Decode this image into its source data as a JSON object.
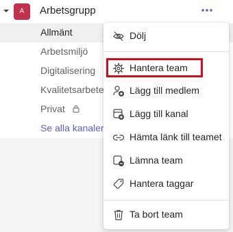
{
  "team": {
    "name": "Arbetsgrupp",
    "avatar_letter": "A",
    "avatar_color": "#c4314b"
  },
  "channels": [
    {
      "label": "Allmänt",
      "selected": true
    },
    {
      "label": "Arbetsmiljö"
    },
    {
      "label": "Digitalisering"
    },
    {
      "label": "Kvalitetsarbete"
    },
    {
      "label": "Privat",
      "private": true,
      "icon": "lock-icon"
    }
  ],
  "see_all_label": "Se alla kanaler",
  "accent_color": "#5b5fc7",
  "highlight_color": "#d40a1e",
  "menu": {
    "items": [
      {
        "label": "Dölj",
        "icon": "eye-off-icon"
      },
      {
        "label": "Hantera team",
        "icon": "gear-icon",
        "highlighted": true
      },
      {
        "label": "Lägg till medlem",
        "icon": "add-person-icon"
      },
      {
        "label": "Lägg till kanal",
        "icon": "add-channel-icon"
      },
      {
        "label": "Hämta länk till teamet",
        "icon": "link-icon"
      },
      {
        "label": "Lämna team",
        "icon": "leave-team-icon"
      },
      {
        "label": "Hantera taggar",
        "icon": "tag-icon"
      },
      {
        "label": "Ta bort team",
        "icon": "trash-icon"
      }
    ]
  }
}
